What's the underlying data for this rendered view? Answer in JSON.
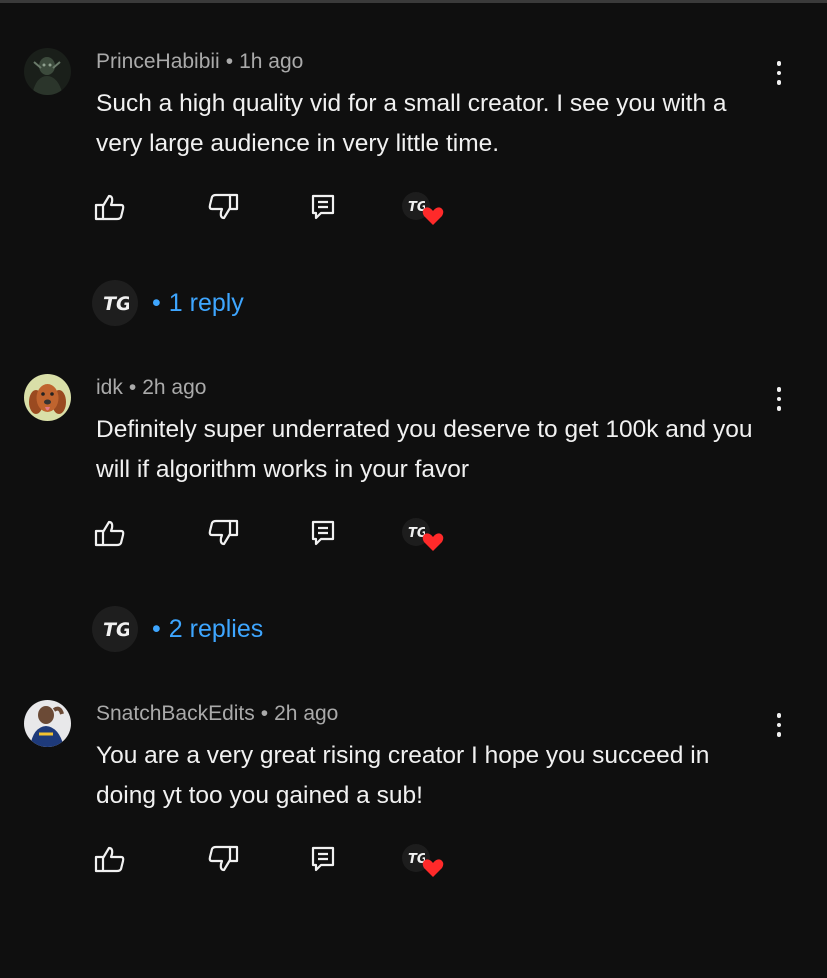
{
  "comments": [
    {
      "author": "PrinceHabibii",
      "separator": "•",
      "time": "1h ago",
      "text": "Such a high quality vid for a small creator. I see you with a very large audience in very little time.",
      "avatar_icon": "dark-figure-avatar",
      "replies": "1 reply",
      "creator_heart": true
    },
    {
      "author": "idk",
      "separator": "•",
      "time": "2h ago",
      "text": "Definitely super underrated you deserve to get 100k and you will if algorithm works in your favor",
      "avatar_icon": "dog-avatar",
      "replies": "2 replies",
      "creator_heart": true
    },
    {
      "author": "SnatchBackEdits",
      "separator": "•",
      "time": "2h ago",
      "text": "You are a very great rising creator I hope you succeed in doing yt too you gained a sub!",
      "avatar_icon": "basketball-player-avatar",
      "creator_heart": true
    }
  ],
  "reply_separator": "•",
  "creator_logo": "TG",
  "colors": {
    "background": "#0f0f0f",
    "meta": "#aaaaaa",
    "text": "#f1f1f1",
    "link": "#3ea6ff",
    "heart": "#ff2a2a"
  },
  "icons": [
    "thumb-up-icon",
    "thumb-down-icon",
    "reply-icon",
    "creator-heart-icon",
    "more-vert-icon"
  ]
}
